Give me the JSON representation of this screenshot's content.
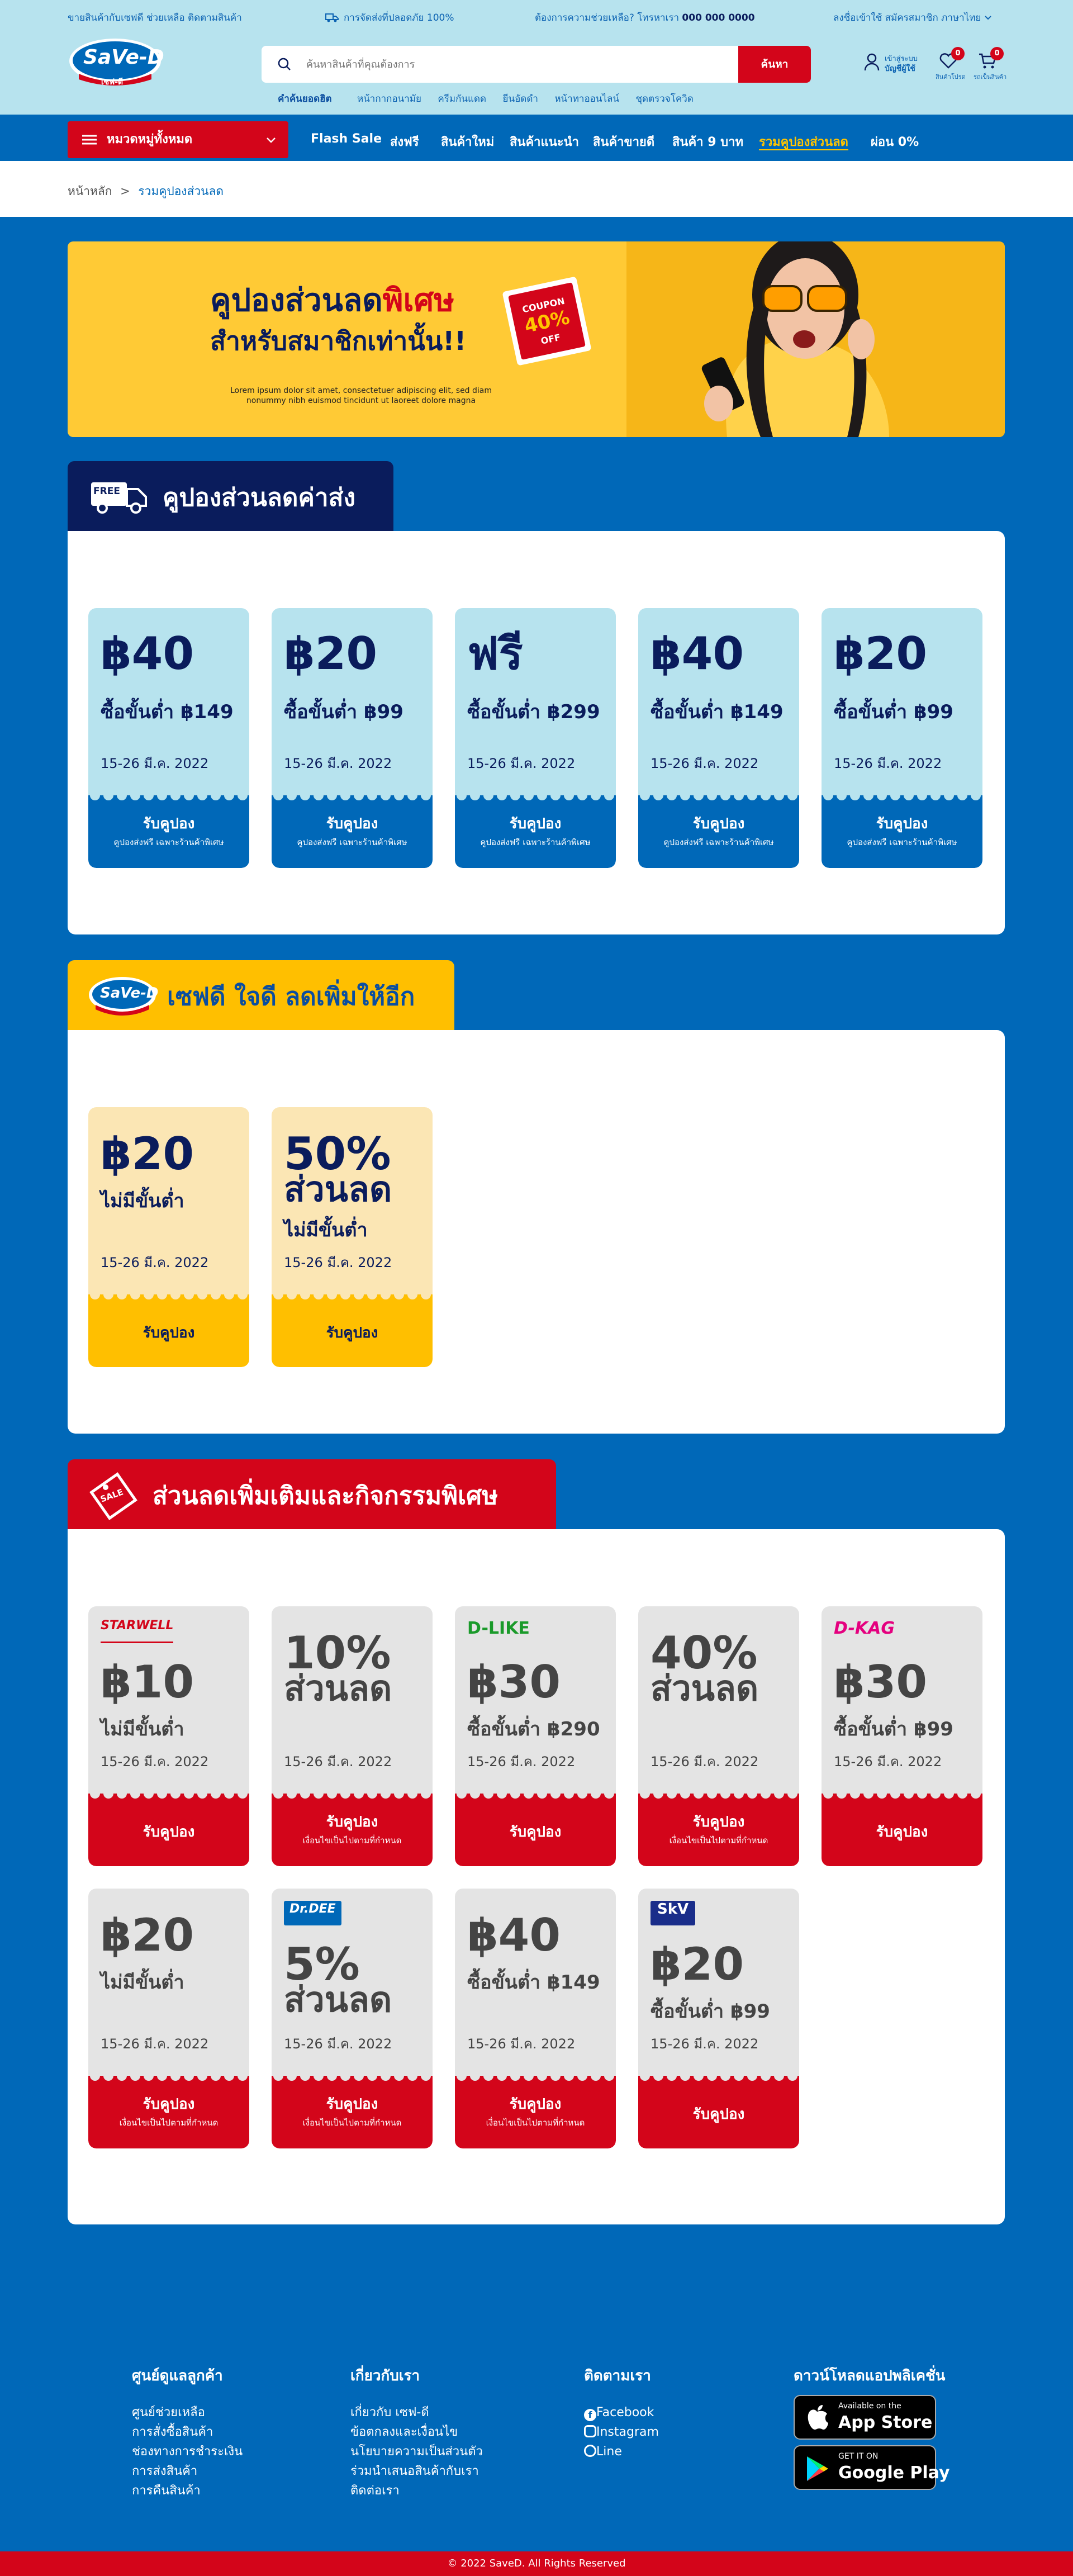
{
  "colors": {
    "primary": "#0068b8",
    "red": "#d3051a",
    "yellow": "#ffbf00",
    "navy": "#0a1c5c",
    "light_blue": "#b7e3ee"
  },
  "topbar": {
    "seller_links": "ขายสินค้ากับเซฟดี ช่วยเหลือ ติดตามสินค้า",
    "shipping": "การจัดส่งที่ปลอดภัย 100%",
    "help_prefix": "ต้องการความช่วยเหลือ? โทรหาเรา",
    "phone": "000 000 0000",
    "right_links": "ลงชื่อเข้าใช้ สมัครสมาชิก ภาษาไทย"
  },
  "logo": {
    "text": "SaVe-D",
    "sub": "เซฟ-ดี"
  },
  "search": {
    "placeholder": "ค้นหาสินค้าที่คุณต้องการ",
    "button": "ค้นหา"
  },
  "popular": {
    "label": "คำค้นยอดฮิต",
    "items": [
      "หน้ากากอนามัย",
      "ครีมกันแดด",
      "ยีนอัดดำ",
      "หน้าทาออนไลน์",
      "ชุดตรวจโควิด"
    ]
  },
  "account": {
    "line1": "เข้าสู่ระบบ",
    "line2": "บัญชีผู้ใช้",
    "wishlist_label": "สินค้าโปรด",
    "wishlist_count": "0",
    "cart_label": "รถเข็นสินค้า",
    "cart_count": "0"
  },
  "nav": {
    "categories": "หมวดหมู่ทั้งหมด",
    "items": [
      "Flash Sale",
      "ส่งฟรี",
      "สินค้าใหม่",
      "สินค้าแนะนำ",
      "สินค้าขายดี",
      "สินค้า 9 บาท",
      "รวมคูปองส่วนลด",
      "ผ่อน 0%"
    ]
  },
  "breadcrumb": {
    "home": "หน้าหลัก",
    "sep": ">",
    "current": "รวมคูปองส่วนลด"
  },
  "banner": {
    "title_a": "คูปองส่วนลด",
    "title_b": "พิเศษ",
    "subtitle": "สำหรับสมาชิกเท่านั้น!!",
    "desc": "Lorem ipsum dolor sit amet, consectetuer adipiscing elit, sed diam nonummy nibh euismod tincidunt ut laoreet dolore magna",
    "tag_top": "COUPON",
    "tag_pct": "40%",
    "tag_off": "OFF"
  },
  "section1": {
    "title": "คูปองส่วนลดค่าส่ง",
    "icon_text": "FREE",
    "cards": [
      {
        "amount": "฿40",
        "cond": "ซื้อขั้นต่ำ ฿149",
        "date": "15-26 มี.ค. 2022",
        "btn": "รับคูปอง",
        "note": "คูปองส่งฟรี เฉพาะร้านค้าพิเศษ"
      },
      {
        "amount": "฿20",
        "cond": "ซื้อขั้นต่ำ ฿99",
        "date": "15-26 มี.ค. 2022",
        "btn": "รับคูปอง",
        "note": "คูปองส่งฟรี เฉพาะร้านค้าพิเศษ"
      },
      {
        "amount": "ฟรี",
        "cond": "ซื้อขั้นต่ำ ฿299",
        "date": "15-26 มี.ค. 2022",
        "btn": "รับคูปอง",
        "note": "คูปองส่งฟรี เฉพาะร้านค้าพิเศษ"
      },
      {
        "amount": "฿40",
        "cond": "ซื้อขั้นต่ำ ฿149",
        "date": "15-26 มี.ค. 2022",
        "btn": "รับคูปอง",
        "note": "คูปองส่งฟรี เฉพาะร้านค้าพิเศษ"
      },
      {
        "amount": "฿20",
        "cond": "ซื้อขั้นต่ำ ฿99",
        "date": "15-26 มี.ค. 2022",
        "btn": "รับคูปอง",
        "note": "คูปองส่งฟรี เฉพาะร้านค้าพิเศษ"
      }
    ]
  },
  "section2": {
    "title": "เซฟดี ใจดี ลดเพิ่มให้อีก",
    "cards": [
      {
        "line1": "฿20",
        "line2": "",
        "cond": "ไม่มีขั้นต่ำ",
        "date": "15-26 มี.ค. 2022",
        "btn": "รับคูปอง"
      },
      {
        "line1": "50%",
        "line2": "ส่วนลด",
        "cond": "ไม่มีขั้นต่ำ",
        "date": "15-26 มี.ค. 2022",
        "btn": "รับคูปอง"
      }
    ]
  },
  "section3": {
    "title": "ส่วนลดเพิ่มเติมและกิจกรรมพิเศษ",
    "icon_text": "SALE",
    "cards": [
      {
        "brand": "STARWELL",
        "line1": "฿10",
        "line2": "",
        "cond": "ไม่มีขั้นต่ำ",
        "date": "15-26 มี.ค. 2022",
        "btn": "รับคูปอง",
        "note": ""
      },
      {
        "brand": "",
        "line1": "10%",
        "line2": "ส่วนลด",
        "cond": "",
        "date": "15-26 มี.ค. 2022",
        "btn": "รับคูปอง",
        "note": "เงื่อนไขเป็นไปตามที่กำหนด"
      },
      {
        "brand": "D-LIKE",
        "line1": "฿30",
        "line2": "",
        "cond": "ซื้อขั้นต่ำ ฿290",
        "date": "15-26 มี.ค. 2022",
        "btn": "รับคูปอง",
        "note": ""
      },
      {
        "brand": "",
        "line1": "40%",
        "line2": "ส่วนลด",
        "cond": "",
        "date": "15-26 มี.ค. 2022",
        "btn": "รับคูปอง",
        "note": "เงื่อนไขเป็นไปตามที่กำหนด"
      },
      {
        "brand": "D-KAG",
        "line1": "฿30",
        "line2": "",
        "cond": "ซื้อขั้นต่ำ ฿99",
        "date": "15-26 มี.ค. 2022",
        "btn": "รับคูปอง",
        "note": ""
      },
      {
        "brand": "",
        "line1": "฿20",
        "line2": "",
        "cond": "ไม่มีขั้นต่ำ",
        "date": "15-26 มี.ค. 2022",
        "btn": "รับคูปอง",
        "note": "เงื่อนไขเป็นไปตามที่กำหนด"
      },
      {
        "brand": "Dr.DEE",
        "line1": "5%",
        "line2": "ส่วนลด",
        "cond": "",
        "date": "15-26 มี.ค. 2022",
        "btn": "รับคูปอง",
        "note": "เงื่อนไขเป็นไปตามที่กำหนด"
      },
      {
        "brand": "",
        "line1": "฿40",
        "line2": "",
        "cond": "ซื้อขั้นต่ำ ฿149",
        "date": "15-26 มี.ค. 2022",
        "btn": "รับคูปอง",
        "note": "เงื่อนไขเป็นไปตามที่กำหนด"
      },
      {
        "brand": "SkV",
        "line1": "฿20",
        "line2": "",
        "cond": "ซื้อขั้นต่ำ ฿99",
        "date": "15-26 มี.ค. 2022",
        "btn": "รับคูปอง",
        "note": ""
      }
    ]
  },
  "footer": {
    "col1": {
      "title": "ศูนย์ดูแลลูกค้า",
      "links": [
        "ศูนย์ช่วยเหลือ",
        "การสั่งซื้อสินค้า",
        "ช่องทางการชำระเงิน",
        "การส่งสินค้า",
        "การคืนสินค้า"
      ]
    },
    "col2": {
      "title": "เกี่ยวกับเรา",
      "links": [
        "เกี่ยวกับ เซฟ-ดี",
        "ข้อตกลงและเงื่อนไข",
        "นโยบายความเป็นส่วนตัว",
        "ร่วมนำเสนอสินค้ากับเรา",
        "ติดต่อเรา"
      ]
    },
    "col3": {
      "title": "ติดตามเรา",
      "links": [
        "Facebook",
        "Instagram",
        "Line"
      ]
    },
    "col4": {
      "title": "ดาวน์โหลดแอปพลิเคชั่น",
      "appstore_small": "Available on the",
      "appstore": "App Store",
      "gplay_small": "GET IT ON",
      "gplay": "Google Play"
    },
    "copyright": "© 2022 SaveD. All Rights Reserved"
  }
}
